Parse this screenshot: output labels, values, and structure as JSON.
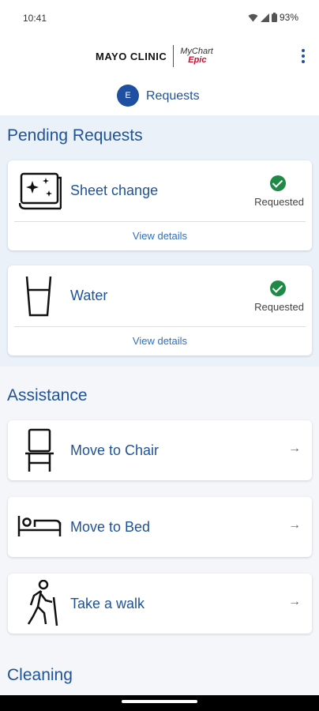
{
  "status": {
    "time": "10:41",
    "battery": "93%"
  },
  "header": {
    "brand_mayo": "MAYO CLINIC",
    "brand_mychart": "MyChart",
    "brand_epic": "Epic",
    "avatar_initial": "E",
    "title": "Requests",
    "menu_icon": "kebab-menu-icon"
  },
  "pending": {
    "title": "Pending Requests",
    "items": [
      {
        "label": "Sheet change",
        "status": "Requested",
        "action": "View details",
        "icon": "sheet-change-icon"
      },
      {
        "label": "Water",
        "status": "Requested",
        "action": "View details",
        "icon": "water-glass-icon"
      }
    ]
  },
  "assistance": {
    "title": "Assistance",
    "items": [
      {
        "label": "Move to Chair",
        "icon": "chair-icon"
      },
      {
        "label": "Move to Bed",
        "icon": "bed-icon"
      },
      {
        "label": "Take a walk",
        "icon": "walking-person-icon"
      }
    ]
  },
  "cleaning": {
    "title": "Cleaning"
  },
  "colors": {
    "accent": "#1e5299",
    "background": "#eaf1f9",
    "success": "#1e8a46",
    "epic": "#c8102e"
  }
}
